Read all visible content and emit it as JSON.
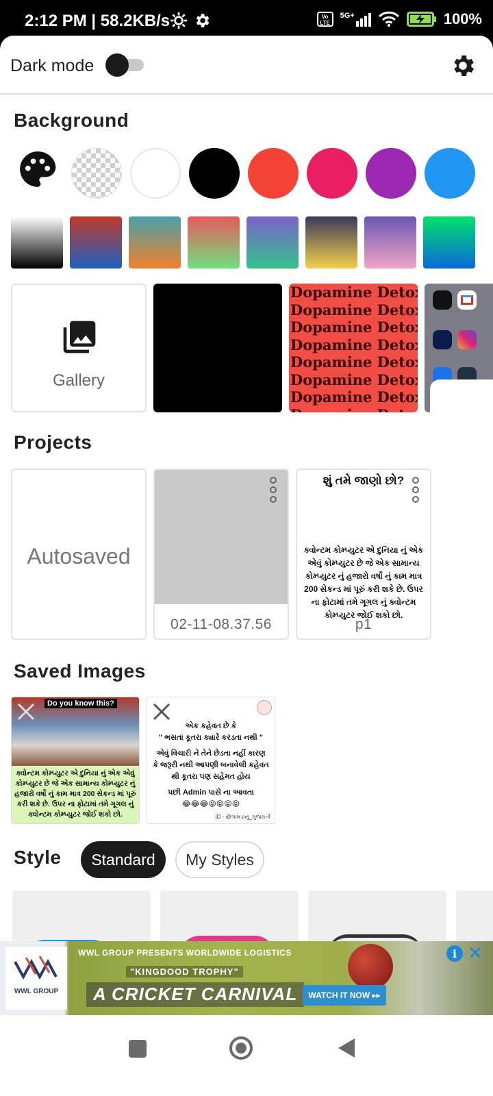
{
  "status_bar": {
    "time_speed": "2:12 PM | 58.2KB/s",
    "network": "5G+",
    "volte": "Vo LTE",
    "battery": "100%"
  },
  "top_bar": {
    "dark_mode_label": "Dark mode",
    "dark_mode_on": false,
    "settings_icon": "gear-icon"
  },
  "background": {
    "title": "Background",
    "solid_colors": [
      "transparent",
      "#ffffff",
      "#000000",
      "#f44336",
      "#e91e63",
      "#9c27b0",
      "#2196f3"
    ],
    "gradients": [
      [
        "#ffffff",
        "#000000"
      ],
      [
        "#c0392b",
        "#1e5fbf"
      ],
      [
        "#4a9fa8",
        "#f0822a"
      ],
      [
        "#e85a5a",
        "#6ee07e"
      ],
      [
        "#7a62c9",
        "#34c28c"
      ],
      [
        "#3c3a5a",
        "#f2d04a"
      ],
      [
        "#6a58b2",
        "#f0a6c6"
      ],
      [
        "#00e06a",
        "#0a6ad8"
      ]
    ],
    "gallery_label": "Gallery",
    "dopamine_lines": [
      "Dopamine Detox",
      "Dopamine Detox",
      "Dopamine Detox",
      "Dopamine Detox",
      "Dopamine Detox",
      "Dopamine Detox",
      "Dopamine Detox",
      "Dopamine Detox"
    ],
    "app_labels": [
      "GitHub",
      "Gmail",
      "Disney+ hotstar",
      "Instagram"
    ]
  },
  "projects": {
    "title": "Projects",
    "autosaved_label": "Autosaved",
    "items": [
      {
        "label": "02-11-08.37.56"
      },
      {
        "label": "p1",
        "heading": "શું તમે જાણો છો?",
        "body": "ક્વોન્ટમ કોમ્પ્યુટર એ દુનિયા નું એક એવું કોમ્પ્યુટર છે જે  એક સામાન્ય કોમ્પ્યુટર નું હજારો વર્ષો નું કામ માત્ર 200 સેકન્ડ માં પૂરું કરી શકે છે. ઉપર ના ફોટામાં તમે ગૂગલ નું ક્વોન્ટમ કોમ્પ્યુટર જોઈ શકો છો."
      }
    ]
  },
  "saved_images": {
    "title": "Saved Images",
    "items": [
      {
        "tag": "Do you know this?",
        "text": "ક્વોન્ટમ કોમ્પ્યુટર એ દુનિયા નું એક એવું કોમ્પ્યુટર છે જે  એક સામાન્ય કોમ્પ્યુટર નું હજારો વર્ષો નું કામ માત્ર 200 સેકન્ડ માં પૂરું કરી શકે છે. ઉપર ના ફોટામાં તમે ગૂગલ નું ક્વોન્ટમ કોમ્પ્યુટર જોઈ શકો છો."
      },
      {
        "text1": "એક કહેવત છે કે",
        "text2": "\" ભસતાં કૂતરા ક્યારે કરડતા નથી \"",
        "text3": "એવું વિચારી ને તેને છેડતા નહીં કારણ કે જરૂરી નથી આપણી બનાવેલી કહેવત થી કૂતરા પણ સહેમત હોય",
        "text4": "પછી Admin પાસે ના આવતા",
        "emoji": "😂😂😂😝😝😝😝",
        "footer": "ID - @ગામડાનું_ગુજરાતી"
      }
    ]
  },
  "style": {
    "title": "Style",
    "chips": [
      "Standard",
      "My Styles"
    ],
    "active_chip": "Standard"
  },
  "ad": {
    "brand": "WWL GROUP",
    "line1": "WWL GROUP PRESENTS WORLDWIDE LOGISTICS",
    "line2": "\"KINGDOOD TROPHY\"",
    "line3": "A CRICKET CARNIVAL",
    "cta": "WATCH IT NOW ▸▸",
    "info": "i",
    "close": "✕"
  },
  "nav": {
    "icons": [
      "recents-square-icon",
      "home-circle-icon",
      "back-triangle-icon"
    ]
  }
}
